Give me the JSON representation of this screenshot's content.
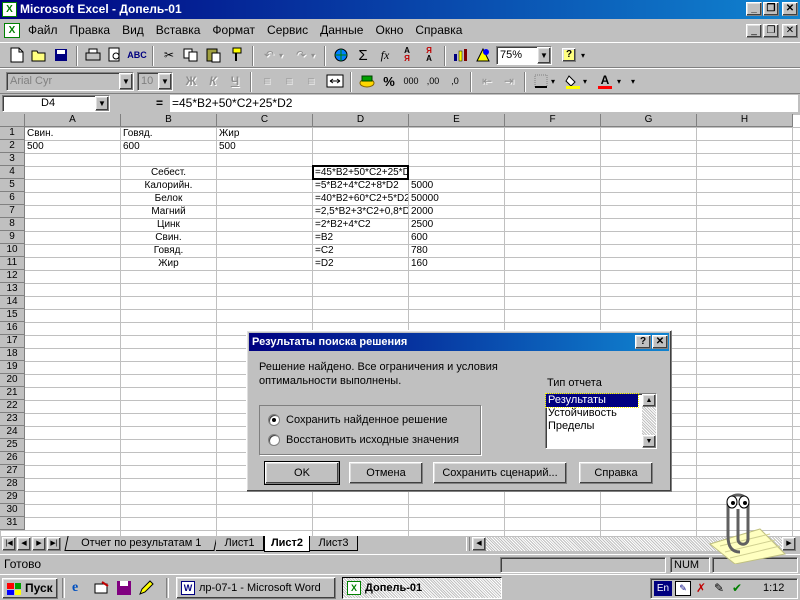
{
  "title_bar": {
    "title": "Microsoft Excel - Допель-01",
    "min": "_",
    "restore": "❐",
    "close": "✕"
  },
  "menu": {
    "items": [
      "Файл",
      "Правка",
      "Вид",
      "Вставка",
      "Формат",
      "Сервис",
      "Данные",
      "Окно",
      "Справка"
    ],
    "doc_min": "_",
    "doc_restore": "❐",
    "doc_close": "✕"
  },
  "toolbar": {
    "zoom": "75%",
    "help": "?"
  },
  "format_toolbar": {
    "font": "Arial Cyr",
    "size": "10",
    "bold": "Ж",
    "italic": "К",
    "underline": "Ч",
    "percent": "%",
    "thousands": "000",
    "inc_dec": ",00",
    "dec_dec": ",0",
    "font_color": "A"
  },
  "formula_bar": {
    "name_box": "D4",
    "equals": "=",
    "formula": "=45*B2+50*C2+25*D2"
  },
  "sheet": {
    "columns": [
      "A",
      "B",
      "C",
      "D",
      "E",
      "F",
      "G",
      "H"
    ],
    "rows": [
      "1",
      "2",
      "3",
      "4",
      "5",
      "6",
      "7",
      "8",
      "9",
      "10",
      "11",
      "12",
      "13",
      "14",
      "15",
      "16",
      "17",
      "18",
      "19",
      "20",
      "21",
      "22",
      "23",
      "24",
      "25",
      "26",
      "27",
      "28",
      "29",
      "30",
      "31"
    ],
    "cells": {
      "A1": "Свин.",
      "B1": "Говяд.",
      "C1": "Жир",
      "A2": "500",
      "B2": "600",
      "C2": "500",
      "B4": "Себест.",
      "B5": "Калорийн.",
      "B6": "Белок",
      "B7": "Магний",
      "B8": "Цинк",
      "B9": "Свин.",
      "B10": "Говяд.",
      "B11": "Жир",
      "D4": "=45*B2+50*C2+25*D2",
      "D5": "=5*B2+4*C2+8*D2",
      "D6": "=40*B2+60*C2+5*D2",
      "D7": "=2,5*B2+3*C2+0,8*D2",
      "D8": "=2*B2+4*C2",
      "D9": "=B2",
      "D10": "=C2",
      "D11": "=D2",
      "E5": "5000",
      "E6": "50000",
      "E7": "2000",
      "E8": "2500",
      "E9": "600",
      "E10": "780",
      "E11": "160"
    },
    "tabs": [
      "Отчет по результатам 1",
      "Лист1",
      "Лист2",
      "Лист3"
    ],
    "active_tab": "Лист2"
  },
  "dialog": {
    "title": "Результаты поиска решения",
    "help": "?",
    "close": "✕",
    "message_line1": "Решение найдено. Все ограничения и условия",
    "message_line2": "оптимальности выполнены.",
    "report_type_label": "Тип отчета",
    "report_types": [
      "Результаты",
      "Устойчивость",
      "Пределы"
    ],
    "selected_report": "Результаты",
    "option_keep": "Сохранить найденное решение",
    "option_restore": "Восстановить исходные значения",
    "btn_ok": "OK",
    "btn_cancel": "Отмена",
    "btn_save_scenario": "Сохранить сценарий...",
    "btn_help": "Справка"
  },
  "status_bar": {
    "ready": "Готово",
    "num": "NUM"
  },
  "taskbar": {
    "start": "Пуск",
    "tasks": [
      "лр-07-1 - Microsoft Word",
      "Допель-01"
    ],
    "active_task": "Допель-01",
    "lang": "En",
    "time": "1:12"
  },
  "colors": {
    "title_active": "#000080",
    "title_gradient_end": "#1084d0",
    "selection": "#000080",
    "window_bg": "#c0c0c0"
  }
}
